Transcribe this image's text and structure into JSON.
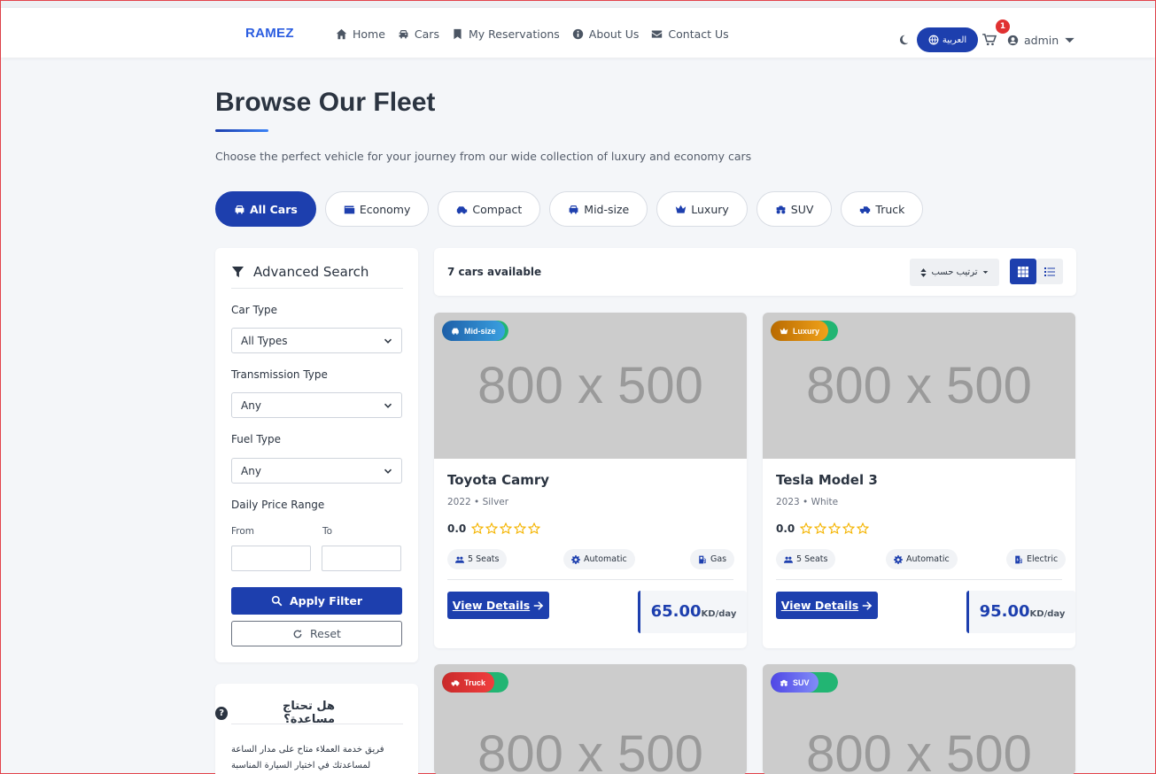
{
  "nav": {
    "brand": "RAMEZ",
    "links": [
      {
        "label": "Home",
        "icon": "home-icon"
      },
      {
        "label": "Cars",
        "icon": "car-icon"
      },
      {
        "label": "My Reservations",
        "icon": "bookmark-icon"
      },
      {
        "label": "About Us",
        "icon": "info-icon"
      },
      {
        "label": "Contact Us",
        "icon": "envelope-icon"
      }
    ],
    "language_label": "العربية",
    "cart_count": "1",
    "user_name": "admin"
  },
  "page": {
    "title": "Browse Our Fleet",
    "subtitle": "Choose the perfect vehicle for your journey from our wide collection of luxury and economy cars"
  },
  "categories": [
    {
      "label": "All Cars",
      "active": true
    },
    {
      "label": "Economy",
      "active": false
    },
    {
      "label": "Compact",
      "active": false
    },
    {
      "label": "Mid-size",
      "active": false
    },
    {
      "label": "Luxury",
      "active": false
    },
    {
      "label": "SUV",
      "active": false
    },
    {
      "label": "Truck",
      "active": false
    }
  ],
  "search": {
    "title": "Advanced Search",
    "car_type_label": "Car Type",
    "car_type_value": "All Types",
    "transmission_label": "Transmission Type",
    "transmission_value": "Any",
    "fuel_label": "Fuel Type",
    "fuel_value": "Any",
    "price_label": "Daily Price Range",
    "from_label": "From",
    "to_label": "To",
    "apply_label": "Apply Filter",
    "reset_label": "Reset"
  },
  "help": {
    "title": "هل تحتاج مساعدة؟",
    "text": "فريق خدمة العملاء متاح على مدار الساعة لمساعدتك في اختيار السيارة المناسبة"
  },
  "results": {
    "count_label": "7 cars available",
    "sort_label": "ترتيب حسب"
  },
  "cars": [
    {
      "category": "Mid-size",
      "category_color": "#2f88d6",
      "image_text": "800 x 500",
      "name": "Toyota Camry",
      "meta": "2022 • Silver",
      "rating": "0.0",
      "seats": "5 Seats",
      "transmission": "Automatic",
      "fuel": "Gas",
      "details_label": "View Details",
      "price": "65.00",
      "unit": "KD/day"
    },
    {
      "category": "Luxury",
      "category_color": "#d98a0b",
      "image_text": "800 x 500",
      "name": "Tesla Model 3",
      "meta": "2023 • White",
      "rating": "0.0",
      "seats": "5 Seats",
      "transmission": "Automatic",
      "fuel": "Electric",
      "details_label": "View Details",
      "price": "95.00",
      "unit": "KD/day"
    },
    {
      "category": "Truck",
      "category_color": "#e03131",
      "image_text": "800 x 500"
    },
    {
      "category": "SUV",
      "category_color": "#6366f1",
      "image_text": "800 x 500"
    }
  ],
  "colors": {
    "primary": "#1d3fae",
    "available": "#22b573",
    "star": "#f4b400"
  }
}
